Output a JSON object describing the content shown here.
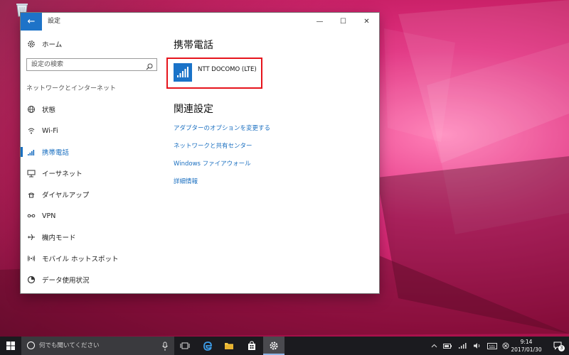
{
  "window": {
    "title": "設定",
    "back_icon": "arrow-left-icon",
    "controls": {
      "minimize": "—",
      "maximize": "☐",
      "close": "✕"
    }
  },
  "nav": {
    "home_label": "ホーム",
    "search_placeholder": "設定の検索",
    "category": "ネットワークとインターネット",
    "items": [
      {
        "label": "状態",
        "icon": "globe-icon"
      },
      {
        "label": "Wi-Fi",
        "icon": "wifi-icon"
      },
      {
        "label": "携帯電話",
        "icon": "cellular-icon",
        "active": true
      },
      {
        "label": "イーサネット",
        "icon": "ethernet-icon"
      },
      {
        "label": "ダイヤルアップ",
        "icon": "dialup-icon"
      },
      {
        "label": "VPN",
        "icon": "vpn-icon"
      },
      {
        "label": "機内モード",
        "icon": "airplane-icon"
      },
      {
        "label": "モバイル ホットスポット",
        "icon": "hotspot-icon"
      },
      {
        "label": "データ使用状況",
        "icon": "data-usage-icon"
      }
    ]
  },
  "content": {
    "heading": "携帯電話",
    "network_name": "NTT DOCOMO (LTE)",
    "related_heading": "関連設定",
    "links": [
      "アダプターのオプションを変更する",
      "ネットワークと共有センター",
      "Windows ファイアウォール",
      "詳細情報"
    ]
  },
  "taskbar": {
    "search_placeholder": "何でも聞いてください",
    "time": "9:14",
    "date": "2017/01/30",
    "notification_count": "3"
  },
  "colors": {
    "accent": "#1a6fc0",
    "highlight_box": "#e6141c",
    "taskbar": "#1b1b1f"
  }
}
